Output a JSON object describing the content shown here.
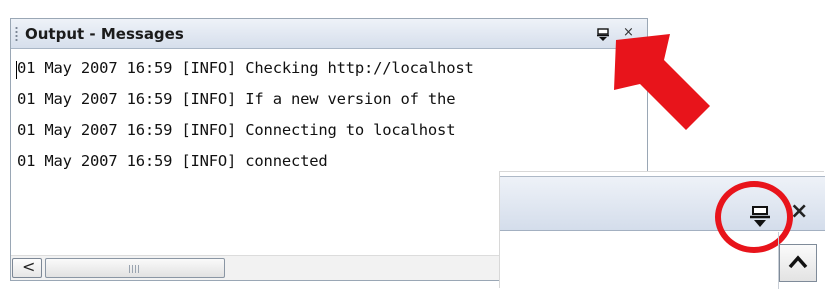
{
  "window": {
    "title": "Output - Messages"
  },
  "log_lines": [
    "01 May 2007 16:59 [INFO] Checking http://localhost",
    "01 May 2007 16:59 [INFO] If a new version of the",
    "01 May 2007 16:59 [INFO] Connecting to localhost",
    "01 May 2007 16:59 [INFO] connected"
  ],
  "scrollbar": {
    "left_arrow": "<",
    "thumb_grip": "III"
  },
  "icons": {
    "pin": "pin-icon",
    "close": "close-icon",
    "scroll_up": "chevron-up-icon"
  },
  "colors": {
    "annotation_red": "#e8141b",
    "title_bar_top": "#eef2f8",
    "title_bar_bottom": "#d6dfec"
  },
  "zoom_inset": {
    "close_glyph": "×"
  }
}
